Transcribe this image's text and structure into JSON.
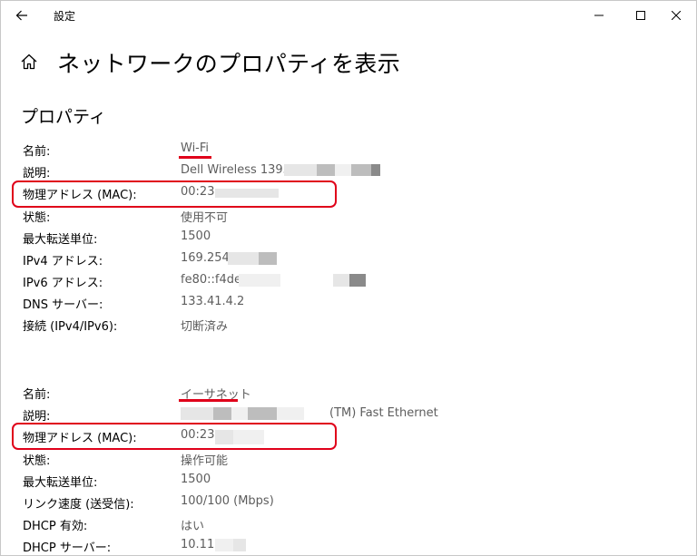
{
  "window": {
    "title": "設定",
    "back_icon": "arrow-left-icon",
    "controls": {
      "minimize": "—",
      "maximize": "☐",
      "close": "✕"
    }
  },
  "header": {
    "home_icon": "home-icon",
    "title": "ネットワークのプロパティを表示"
  },
  "section": {
    "title": "プロパティ"
  },
  "adapters": [
    {
      "rows": [
        {
          "label": "名前:",
          "value": "Wi-Fi"
        },
        {
          "label": "説明:",
          "value": "Dell Wireless 1395"
        },
        {
          "label": "物理アドレス (MAC):",
          "value": "00:23:"
        },
        {
          "label": "状態:",
          "value": "使用不可"
        },
        {
          "label": "最大転送単位:",
          "value": "1500"
        },
        {
          "label": "IPv4 アドレス:",
          "value": "169.254."
        },
        {
          "label": "IPv6 アドレス:",
          "value": "fe80::f4de"
        },
        {
          "label": "DNS サーバー:",
          "value": "133.41.4.2"
        },
        {
          "label": "接続 (IPv4/IPv6):",
          "value": "切断済み"
        }
      ]
    },
    {
      "rows": [
        {
          "label": "名前:",
          "value": "イーサネット"
        },
        {
          "label": "説明:",
          "value": "(TM) Fast Ethernet"
        },
        {
          "label": "物理アドレス (MAC):",
          "value": "00:23:"
        },
        {
          "label": "状態:",
          "value": "操作可能"
        },
        {
          "label": "最大転送単位:",
          "value": "1500"
        },
        {
          "label": "リンク速度 (送受信):",
          "value": "100/100 (Mbps)"
        },
        {
          "label": "DHCP 有効:",
          "value": "はい"
        },
        {
          "label": "DHCP サーバー:",
          "value": "10.11."
        }
      ]
    }
  ],
  "colors": {
    "highlight": "#e0001a",
    "value_text": "#5d5d5d",
    "redaction": "#e6e6e6"
  }
}
